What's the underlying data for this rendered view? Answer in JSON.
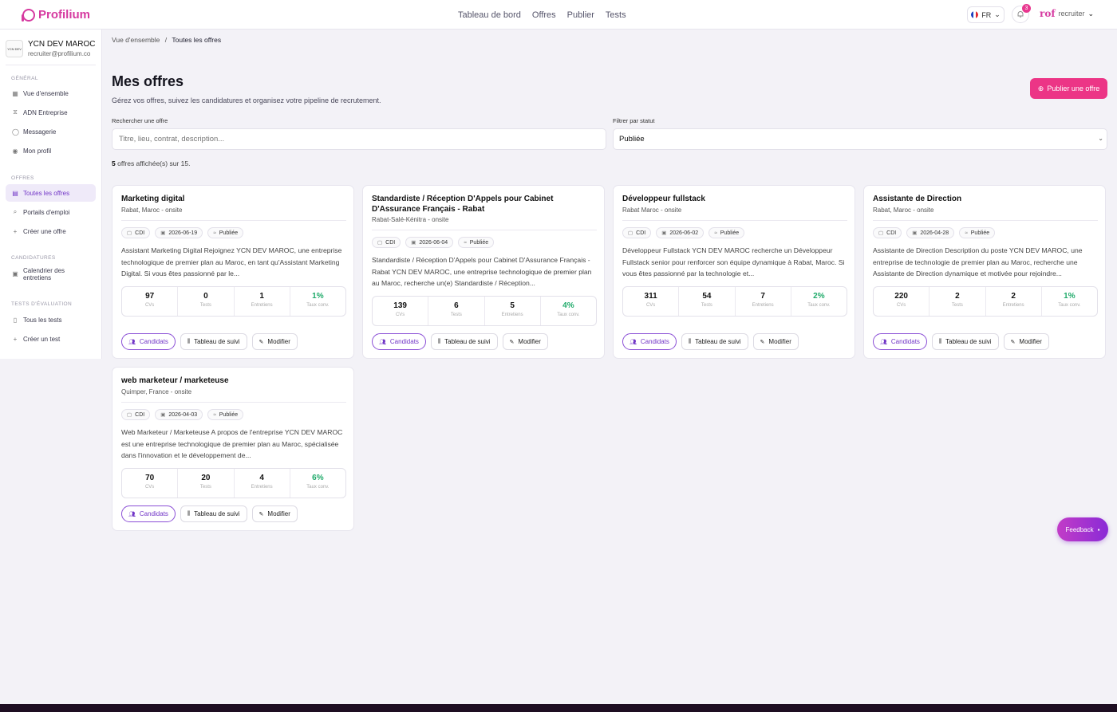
{
  "brand": {
    "name": "Profilium"
  },
  "topnav": [
    "Tableau de bord",
    "Offres",
    "Publier",
    "Tests"
  ],
  "header": {
    "lang": "FR",
    "notif_count": "3",
    "user": "recruiter",
    "user_logo_text": "rof"
  },
  "company": {
    "logo_text": "YCN DEV",
    "name": "YCN DEV MAROC",
    "email": "recruiter@profilium.co"
  },
  "sidebar": {
    "sections": [
      {
        "title": "GÉNÉRAL",
        "items": [
          {
            "label": "Vue d'ensemble",
            "icon": "grid-icon"
          },
          {
            "label": "ADN Entreprise",
            "icon": "dna-icon"
          },
          {
            "label": "Messagerie",
            "icon": "message-icon"
          },
          {
            "label": "Mon profil",
            "icon": "profile-icon"
          }
        ]
      },
      {
        "title": "OFFRES",
        "items": [
          {
            "label": "Toutes les offres",
            "icon": "offers-icon",
            "active": true
          },
          {
            "label": "Portails d'emploi",
            "icon": "portal-icon"
          },
          {
            "label": "Créer une offre",
            "icon": "plus-icon"
          }
        ]
      },
      {
        "title": "CANDIDATURES",
        "items": [
          {
            "label": "Calendrier des entretiens",
            "icon": "calendar-icon"
          }
        ]
      },
      {
        "title": "TESTS D'ÉVALUATION",
        "items": [
          {
            "label": "Tous les tests",
            "icon": "clipboard-icon"
          },
          {
            "label": "Créer un test",
            "icon": "plus-icon"
          }
        ]
      }
    ]
  },
  "breadcrumb": {
    "parent": "Vue d'ensemble",
    "separator": "/",
    "current": "Toutes les offres"
  },
  "page": {
    "title": "Mes offres",
    "subtitle": "Gérez vos offres, suivez les candidatures et organisez votre pipeline de recrutement.",
    "publish_label": "Publier une offre"
  },
  "filters": {
    "search_label": "Rechercher une offre",
    "search_placeholder": "Titre, lieu, contrat, description...",
    "status_label": "Filtrer par statut",
    "status_value": "Publiée"
  },
  "results": {
    "shown": "5",
    "text": " offres affichée(s) sur 15."
  },
  "stat_labels": {
    "cvs": "CVs",
    "tests": "Tests",
    "interviews": "Entretiens",
    "rate": "Taux conv."
  },
  "button_labels": {
    "candidates": "Candidats",
    "tracking": "Tableau de suivi",
    "edit": "Modifier"
  },
  "offers": [
    {
      "title": "Marketing digital",
      "location": "Rabat, Maroc - onsite",
      "contract": "CDI",
      "date": "2026-06-19",
      "status": "Publiée",
      "description": "Assistant Marketing Digital Rejoignez YCN DEV MAROC, une entreprise technologique de premier plan au Maroc, en tant qu'Assistant Marketing Digital. Si vous êtes passionné par le...",
      "cvs": "97",
      "tests": "0",
      "interviews": "1",
      "rate": "1%"
    },
    {
      "title": "Standardiste / Réception D'Appels pour Cabinet D'Assurance Français - Rabat",
      "location": "Rabat-Salé-Kénitra - onsite",
      "contract": "CDI",
      "date": "2026-06-04",
      "status": "Publiée",
      "description": "Standardiste / Réception D'Appels pour Cabinet D'Assurance Français - Rabat YCN DEV MAROC, une entreprise technologique de premier plan au Maroc, recherche un(e) Standardiste / Réception...",
      "cvs": "139",
      "tests": "6",
      "interviews": "5",
      "rate": "4%"
    },
    {
      "title": "Développeur fullstack",
      "location": "Rabat Maroc - onsite",
      "contract": "CDI",
      "date": "2026-06-02",
      "status": "Publiée",
      "description": "Développeur Fullstack YCN DEV MAROC recherche un Développeur Fullstack senior pour renforcer son équipe dynamique à Rabat, Maroc. Si vous êtes passionné par la technologie et...",
      "cvs": "311",
      "tests": "54",
      "interviews": "7",
      "rate": "2%"
    },
    {
      "title": "Assistante de Direction",
      "location": "Rabat, Maroc - onsite",
      "contract": "CDI",
      "date": "2026-04-28",
      "status": "Publiée",
      "description": "Assistante de Direction Description du poste YCN DEV MAROC, une entreprise de technologie de premier plan au Maroc, recherche une Assistante de Direction dynamique et motivée pour rejoindre...",
      "cvs": "220",
      "tests": "2",
      "interviews": "2",
      "rate": "1%"
    },
    {
      "title": "web marketeur / marketeuse",
      "location": "Quimper, France - onsite",
      "contract": "CDI",
      "date": "2026-04-03",
      "status": "Publiée",
      "description": "Web Marketeur / Marketeuse A propos de l'entreprise YCN DEV MAROC est une entreprise technologique de premier plan au Maroc, spécialisée dans l'innovation et le développement de...",
      "cvs": "70",
      "tests": "20",
      "interviews": "4",
      "rate": "6%"
    }
  ],
  "feedback": {
    "label": "Feedback"
  },
  "colors": {
    "accent": "#ec3586",
    "purple": "#7236c7",
    "rate_green": "#1faa6a",
    "background": "#f3f2f7"
  }
}
